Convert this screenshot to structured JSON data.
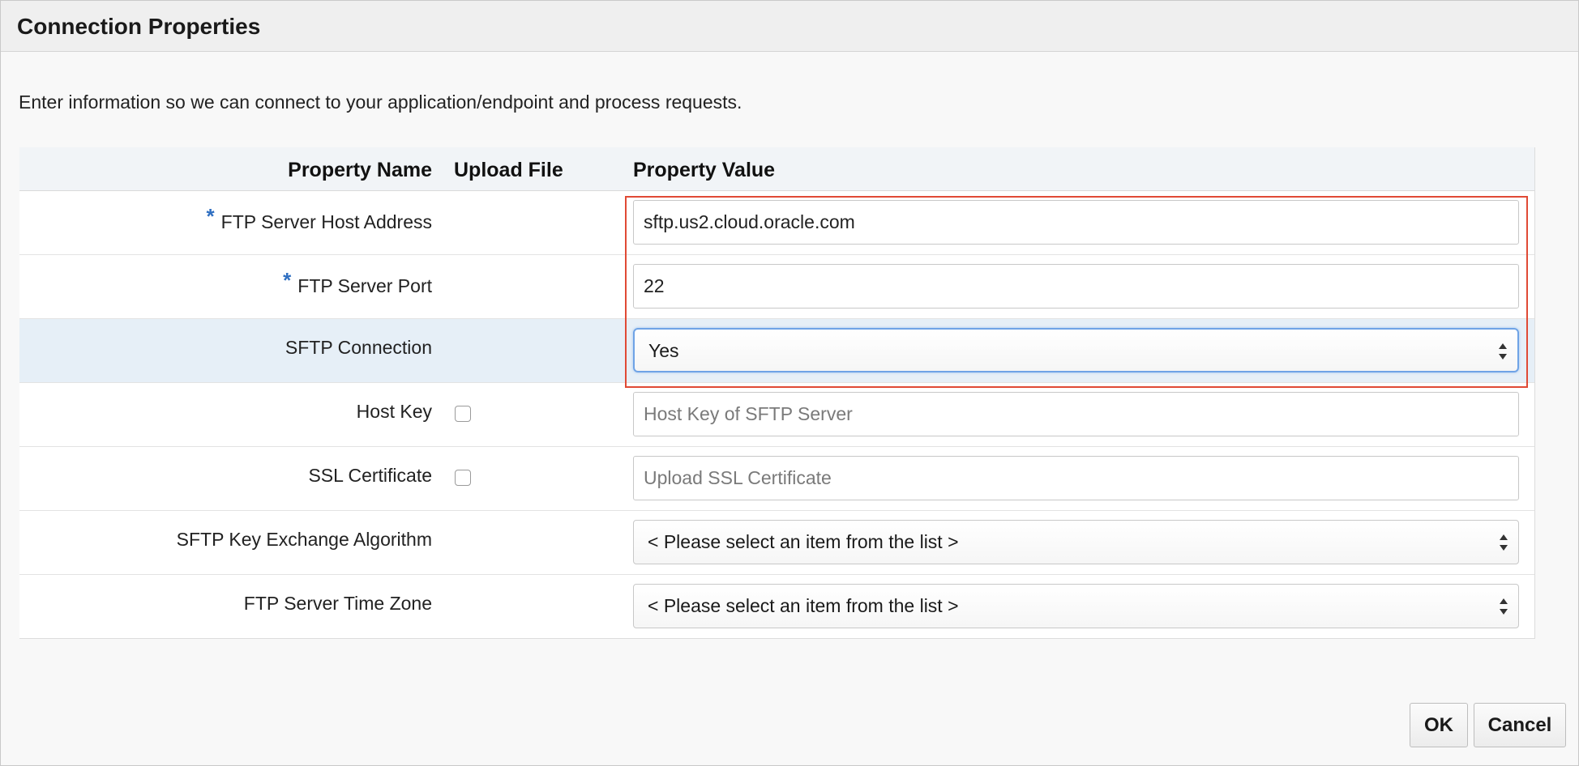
{
  "dialog": {
    "title": "Connection Properties",
    "intro": "Enter information so we can connect to your application/endpoint and process requests."
  },
  "table": {
    "headers": {
      "property_name": "Property Name",
      "upload_file": "Upload File",
      "property_value": "Property Value"
    },
    "required_marker": "*",
    "rows": [
      {
        "name": "FTP Server Host Address",
        "required": true,
        "value": "sftp.us2.cloud.oracle.com"
      },
      {
        "name": "FTP Server Port",
        "required": true,
        "value": "22"
      },
      {
        "name": "SFTP Connection",
        "required": false,
        "selected_option": "Yes"
      },
      {
        "name": "Host Key",
        "required": false,
        "upload_checked": false,
        "placeholder": "Host Key of SFTP Server"
      },
      {
        "name": "SSL Certificate",
        "required": false,
        "upload_checked": false,
        "placeholder": "Upload SSL Certificate"
      },
      {
        "name": "SFTP Key Exchange Algorithm",
        "required": false,
        "selected_option": "< Please select an item from the list >"
      },
      {
        "name": "FTP Server Time Zone",
        "required": false,
        "selected_option": "< Please select an item from the list >"
      }
    ]
  },
  "buttons": {
    "ok": "OK",
    "cancel": "Cancel"
  },
  "colors": {
    "required_marker": "#2f6fc1",
    "highlight_border": "#e04a35",
    "focus_ring": "#6fa3e6",
    "selected_row": "#e6eff7"
  },
  "icons": {
    "select_arrows": "up-down-arrows-icon"
  }
}
